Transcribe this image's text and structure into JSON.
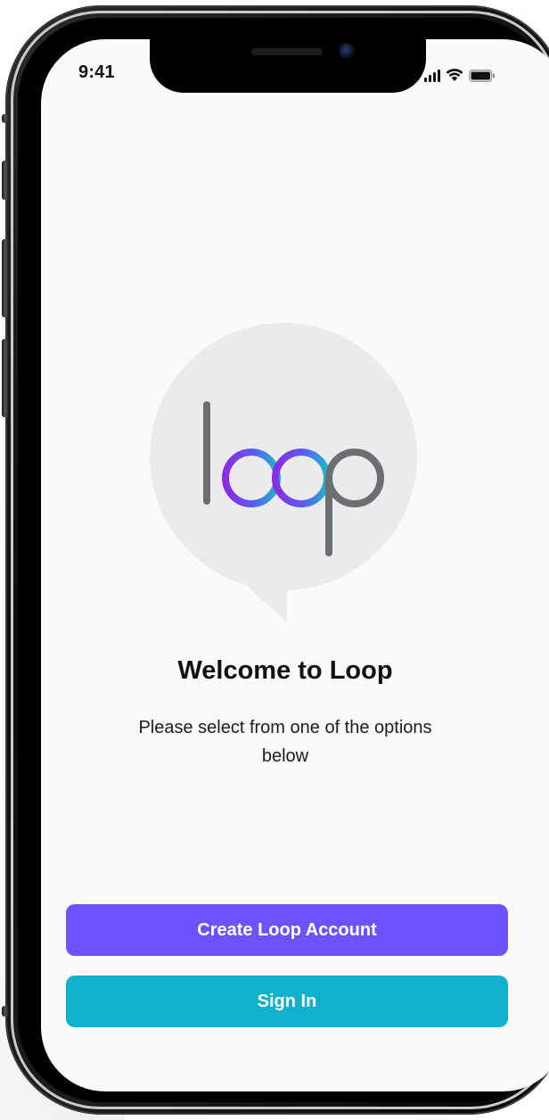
{
  "status_bar": {
    "time": "9:41",
    "icons": [
      "cellular-signal-icon",
      "wifi-icon",
      "battery-icon"
    ]
  },
  "logo": {
    "text": "loop",
    "bubble_color": "#ebebed",
    "letter_color": "#6b6e72",
    "gradient_colors": [
      "#8a2be2",
      "#5b5cf6",
      "#1fb6c8"
    ]
  },
  "welcome": {
    "title": "Welcome to Loop",
    "subtitle": "Please select from one of the options below"
  },
  "actions": {
    "create_account_label": "Create Loop Account",
    "sign_in_label": "Sign In"
  },
  "colors": {
    "create_button": "#6a55fd",
    "sign_in_button": "#0fb1cc",
    "screen_background": "#fafafb"
  }
}
